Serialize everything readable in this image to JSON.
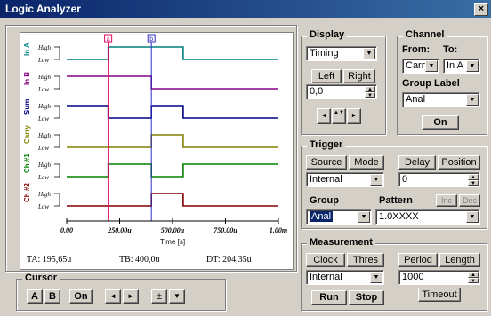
{
  "window": {
    "title": "Logic Analyzer",
    "close": "×"
  },
  "plot": {
    "channels": [
      {
        "name": "In A",
        "color": "#008080"
      },
      {
        "name": "In B",
        "color": "#800080"
      },
      {
        "name": "Sum",
        "color": "#000080"
      },
      {
        "name": "Carry",
        "color": "#808000"
      },
      {
        "name": "Ch #1",
        "color": "#008000"
      },
      {
        "name": "Ch #2",
        "color": "#800000"
      }
    ],
    "high_label": "High",
    "low_label": "Low",
    "x_ticks": [
      "0.00",
      "250.00u",
      "500.00u",
      "750.00u",
      "1.00m"
    ],
    "x_label": "Time [s]",
    "cursor_a_tag": "a",
    "cursor_b_tag": "b",
    "readouts": {
      "ta": "TA: 195,65u",
      "tb": "TB: 400,0u",
      "dt": "DT: 204,35u"
    }
  },
  "cursor": {
    "title": "Cursor",
    "a_label": "A",
    "b_label": "B",
    "on_label": "On",
    "left_arrow": "◄",
    "right_arrow": "►",
    "move_label": "±",
    "down_label": "▼"
  },
  "display": {
    "title": "Display",
    "mode_value": "Timing",
    "left_label": "Left",
    "right_label": "Right",
    "position_value": "0,0",
    "nav_left": "◄",
    "nav_center": "▲▼",
    "nav_right": "►"
  },
  "channel": {
    "title": "Channel",
    "from_label": "From:",
    "to_label": "To:",
    "from_value": "Carry",
    "to_value": "In A",
    "group_label_title": "Group Label",
    "group_label_value": "Anal",
    "on_label": "On"
  },
  "trigger": {
    "title": "Trigger",
    "source_label": "Source",
    "mode_label": "Mode",
    "delay_label": "Delay",
    "position_label": "Position",
    "source_value": "Internal",
    "delay_value": "0",
    "group_title": "Group",
    "pattern_title": "Pattern",
    "inc_label": "Inc",
    "dec_label": "Dec",
    "group_value": "Anal",
    "pattern_value": "1.0XXXX"
  },
  "measurement": {
    "title": "Measurement",
    "clock_label": "Clock",
    "thres_label": "Thres",
    "period_label": "Period",
    "length_label": "Length",
    "clock_value": "Internal",
    "period_value": "1000",
    "run_label": "Run",
    "stop_label": "Stop",
    "timeout_label": "Timeout"
  }
}
